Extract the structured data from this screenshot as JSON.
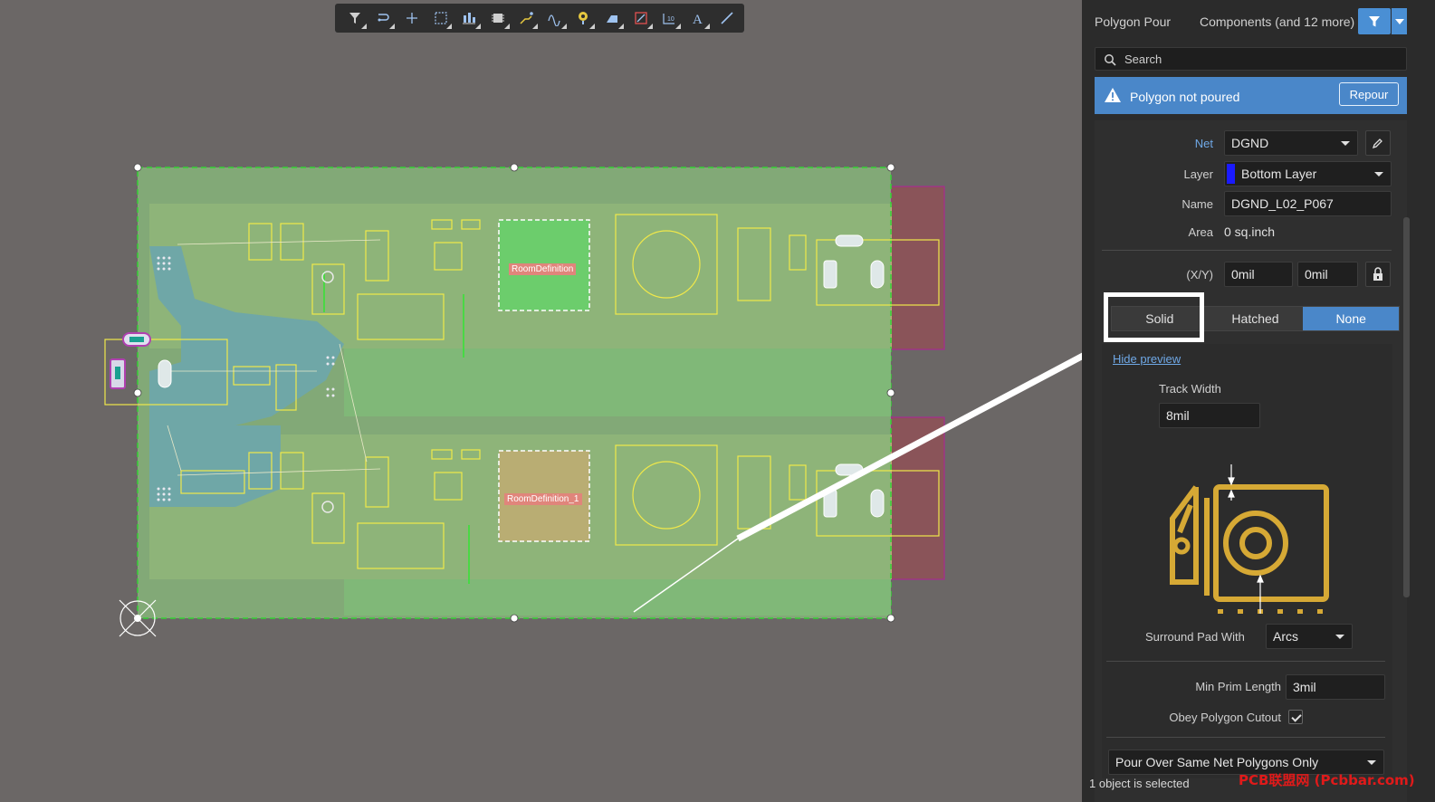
{
  "toolbar": {
    "buttons": [
      "filter-icon",
      "interactive-route-icon",
      "cross-icon",
      "select-rect-icon",
      "align-icon",
      "component-icon",
      "route-icon",
      "diff-pair-icon",
      "via-icon",
      "fill-icon",
      "keepout-icon",
      "dimension-icon",
      "text-icon",
      "line-icon"
    ]
  },
  "canvas": {
    "rooms": [
      "RoomDefinition",
      "RoomDefinition_1"
    ]
  },
  "panel": {
    "title": "Polygon Pour",
    "filter_text": "Components (and 12 more)",
    "search_placeholder": "Search",
    "alert": {
      "message": "Polygon not poured",
      "button": "Repour"
    },
    "net": {
      "label": "Net",
      "value": "DGND"
    },
    "layer": {
      "label": "Layer",
      "value": "Bottom Layer",
      "color": "#1a1aff"
    },
    "name": {
      "label": "Name",
      "value": "DGND_L02_P067"
    },
    "area": {
      "label": "Area",
      "value": "0 sq.inch"
    },
    "xy": {
      "label": "(X/Y)",
      "x": "0mil",
      "y": "0mil"
    },
    "fill_modes": [
      "Solid",
      "Hatched",
      "None"
    ],
    "fill_mode_selected": "None",
    "hide_preview": "Hide preview",
    "track_width": {
      "label": "Track Width",
      "value": "8mil"
    },
    "surround": {
      "label": "Surround Pad With",
      "value": "Arcs"
    },
    "min_prim": {
      "label": "Min Prim Length",
      "value": "3mil"
    },
    "obey_cutout": {
      "label": "Obey Polygon Cutout",
      "checked": true
    },
    "pour_over": "Pour Over Same Net Polygons Only"
  },
  "status": {
    "text": "1 object is selected"
  },
  "watermark": "PCB联盟网 (Pcbbar.com)"
}
